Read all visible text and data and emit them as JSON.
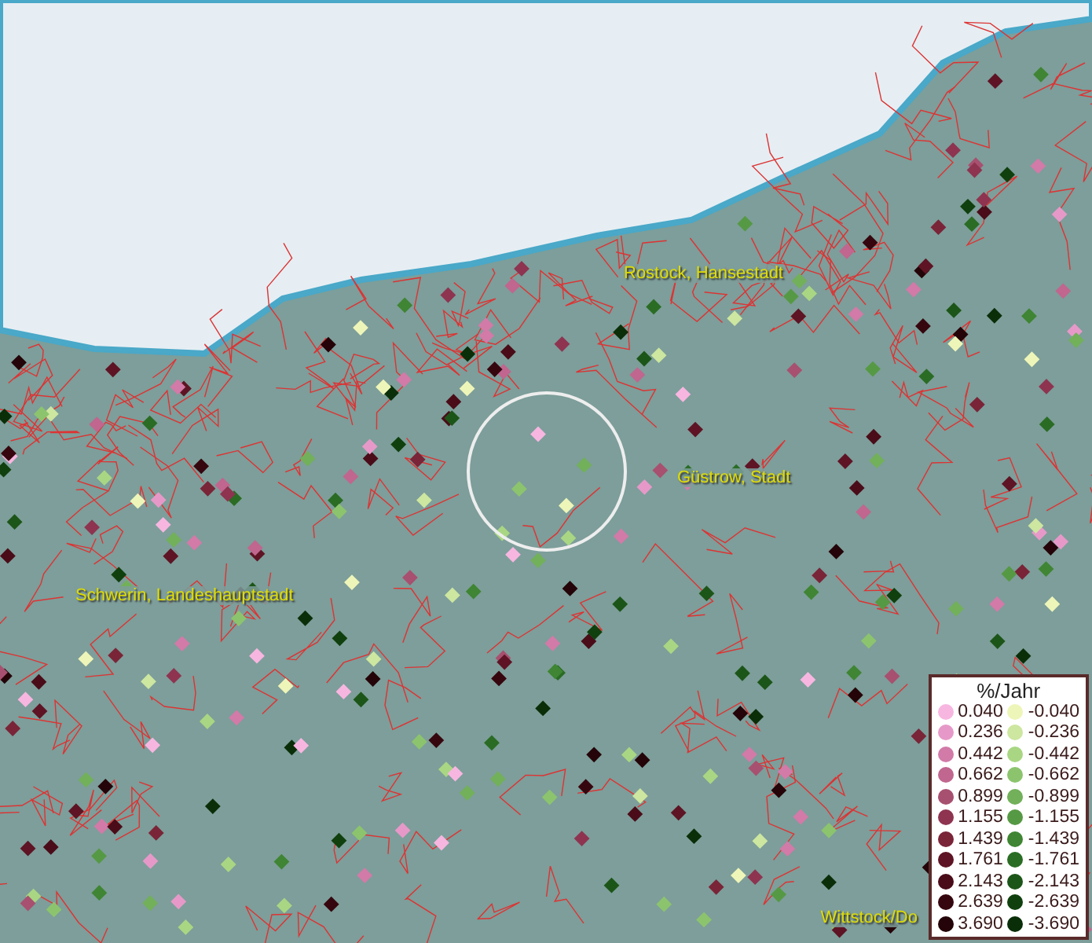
{
  "map": {
    "places": [
      {
        "name": "Rostock, Hansestadt"
      },
      {
        "name": "Güstrow, Stadt"
      },
      {
        "name": "Schwerin, Landeshauptstadt"
      },
      {
        "name": "Wittstock/Do"
      }
    ]
  },
  "legend": {
    "title": "%/Jahr",
    "rows": [
      {
        "pos": {
          "label": "0.040",
          "color": "#f7b6e0"
        },
        "neg": {
          "label": "-0.040",
          "color": "#eef5b8"
        }
      },
      {
        "pos": {
          "label": "0.236",
          "color": "#e699c8"
        },
        "neg": {
          "label": "-0.236",
          "color": "#cde6a0"
        }
      },
      {
        "pos": {
          "label": "0.442",
          "color": "#d27aa8"
        },
        "neg": {
          "label": "-0.442",
          "color": "#a9d683"
        }
      },
      {
        "pos": {
          "label": "0.662",
          "color": "#c0668f"
        },
        "neg": {
          "label": "-0.662",
          "color": "#8cc46e"
        }
      },
      {
        "pos": {
          "label": "0.899",
          "color": "#a8506f"
        },
        "neg": {
          "label": "-0.899",
          "color": "#72b05a"
        }
      },
      {
        "pos": {
          "label": "1.155",
          "color": "#8e3450"
        },
        "neg": {
          "label": "-1.155",
          "color": "#569944"
        }
      },
      {
        "pos": {
          "label": "1.439",
          "color": "#7a2438"
        },
        "neg": {
          "label": "-1.439",
          "color": "#3f8533"
        }
      },
      {
        "pos": {
          "label": "1.761",
          "color": "#5e1424"
        },
        "neg": {
          "label": "-1.761",
          "color": "#2a6c24"
        }
      },
      {
        "pos": {
          "label": "2.143",
          "color": "#4a0c18"
        },
        "neg": {
          "label": "-2.143",
          "color": "#1c5518"
        }
      },
      {
        "pos": {
          "label": "2.639",
          "color": "#36060e"
        },
        "neg": {
          "label": "-2.639",
          "color": "#10400e"
        }
      },
      {
        "pos": {
          "label": "3.690",
          "color": "#240408"
        },
        "neg": {
          "label": "-3.690",
          "color": "#0a2e08"
        }
      }
    ]
  }
}
